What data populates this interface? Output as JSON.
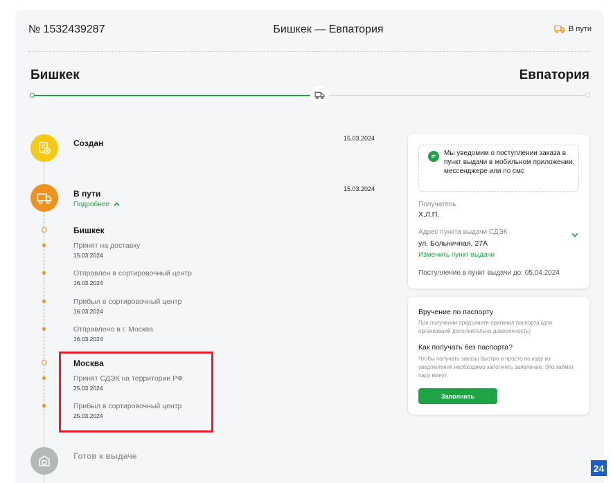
{
  "order": {
    "number": "№ 1532439287",
    "route": "Бишкек — Евпатория",
    "status": "В пути",
    "status_icon": "truck-icon"
  },
  "route_bar": {
    "from": "Бишкек",
    "to": "Евпатория",
    "progress_fraction": 0.5
  },
  "timeline": {
    "created": {
      "title": "Создан",
      "date": "15.03.2024"
    },
    "in_transit": {
      "title": "В пути",
      "date": "15.03.2024",
      "more_label": "Подробнее"
    },
    "groups": [
      {
        "city": "Бишкек",
        "events": [
          {
            "name": "Принят на доставку",
            "date": "15.03.2024"
          },
          {
            "name": "Отправлен в сортировочный центр",
            "date": "16.03.2024"
          },
          {
            "name": "Прибыл в сортировочный центр",
            "date": "16.03.2024"
          },
          {
            "name": "Отправлено в г. Москва",
            "date": "16.03.2024"
          }
        ]
      },
      {
        "city": "Москва",
        "events": [
          {
            "name": "Принят СДЭК на территории РФ",
            "date": "25.03.2024"
          },
          {
            "name": "Прибыл в сортировочный центр",
            "date": "25.03.2024"
          }
        ]
      }
    ],
    "ready": {
      "title": "Готов к выдаче"
    }
  },
  "delivery_card": {
    "notice": "Мы уведомим о поступлении заказа в пункт выдачи в мобильном приложении, мессенджере или по смс",
    "recipient_label": "Получатель",
    "recipient_value": "Х.Л.П.",
    "address_label": "Адрес пункта выдачи СДЭК",
    "address_value": "ул. Больничная, 27А",
    "change_link": "Изменить пункт выдачи",
    "arrival": "Поступление в пункт выдачи до: 05.04.2024"
  },
  "passport_card": {
    "title": "Вручение по паспорту",
    "desc": "При получении предъявите оригинал паспорта (для организаций дополнительно доверенность)",
    "question": "Как получать без паспорта?",
    "question_desc": "Чтобы получать заказы быстро и просто по коду из уведомления необходимо заполнить заявление. Это займет пару минут.",
    "button": "Заполнить"
  },
  "widget_badge": "24",
  "colors": {
    "green": "#1ea345",
    "orange": "#f0901e",
    "yellow": "#f7c915",
    "grey": "#b5b8bb",
    "highlight": "#e4202d"
  }
}
